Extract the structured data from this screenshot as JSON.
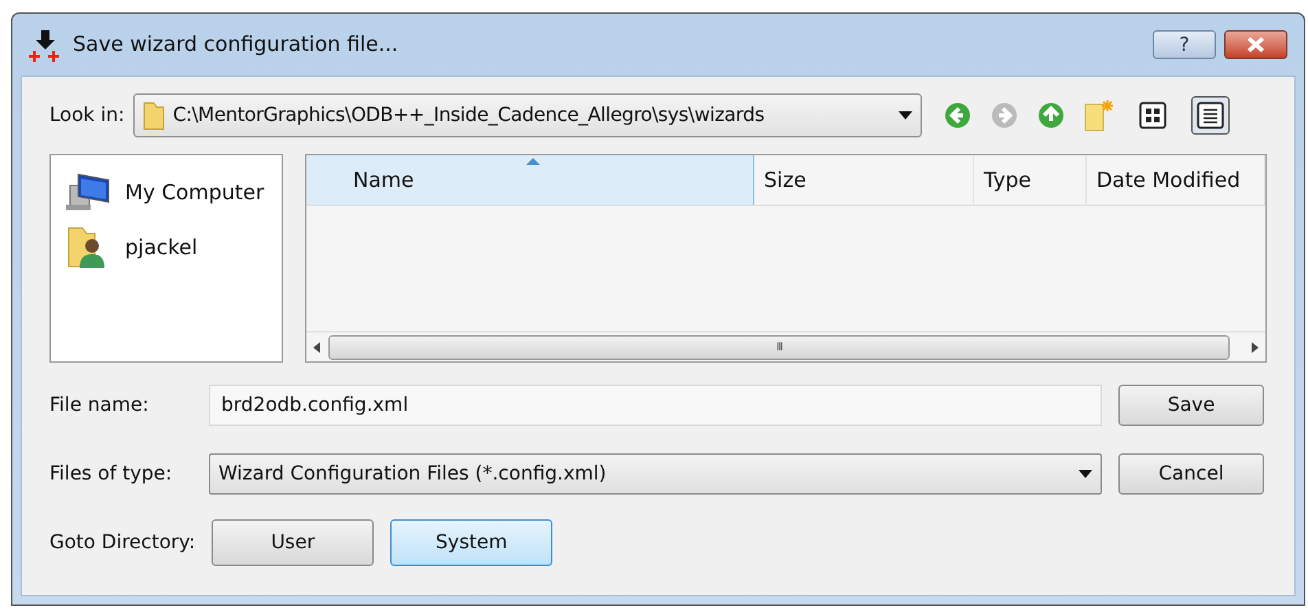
{
  "window": {
    "title": "Save wizard configuration file...",
    "help": "?"
  },
  "look_in": {
    "label": "Look in:",
    "path": "C:\\MentorGraphics\\ODB++_Inside_Cadence_Allegro\\sys\\wizards"
  },
  "toolbar": [
    {
      "kind": "back",
      "disabled": false
    },
    {
      "kind": "forward",
      "disabled": true
    },
    {
      "kind": "up",
      "disabled": false
    },
    {
      "kind": "new-folder",
      "disabled": false
    },
    {
      "kind": "list-view",
      "selected": false
    },
    {
      "kind": "detail-view",
      "selected": true
    }
  ],
  "sidebar": {
    "items": [
      {
        "kind": "computer",
        "label": "My Computer"
      },
      {
        "kind": "user",
        "label": "pjackel"
      }
    ]
  },
  "table": {
    "columns": [
      {
        "label": "Name",
        "sorted": true
      },
      {
        "label": "Size",
        "sorted": false
      },
      {
        "label": "Type",
        "sorted": false
      },
      {
        "label": "Date Modified",
        "sorted": false
      }
    ],
    "scroll_mark": "III"
  },
  "file_name": {
    "label": "File name:",
    "value": "brd2odb.config.xml"
  },
  "file_type": {
    "label": "Files of type:",
    "value": "Wizard Configuration Files (*.config.xml)"
  },
  "buttons": [
    "Save",
    "Cancel"
  ],
  "goto": {
    "label": "Goto Directory:",
    "buttons": [
      {
        "label": "User",
        "selected": false
      },
      {
        "label": "System",
        "selected": true
      }
    ]
  }
}
